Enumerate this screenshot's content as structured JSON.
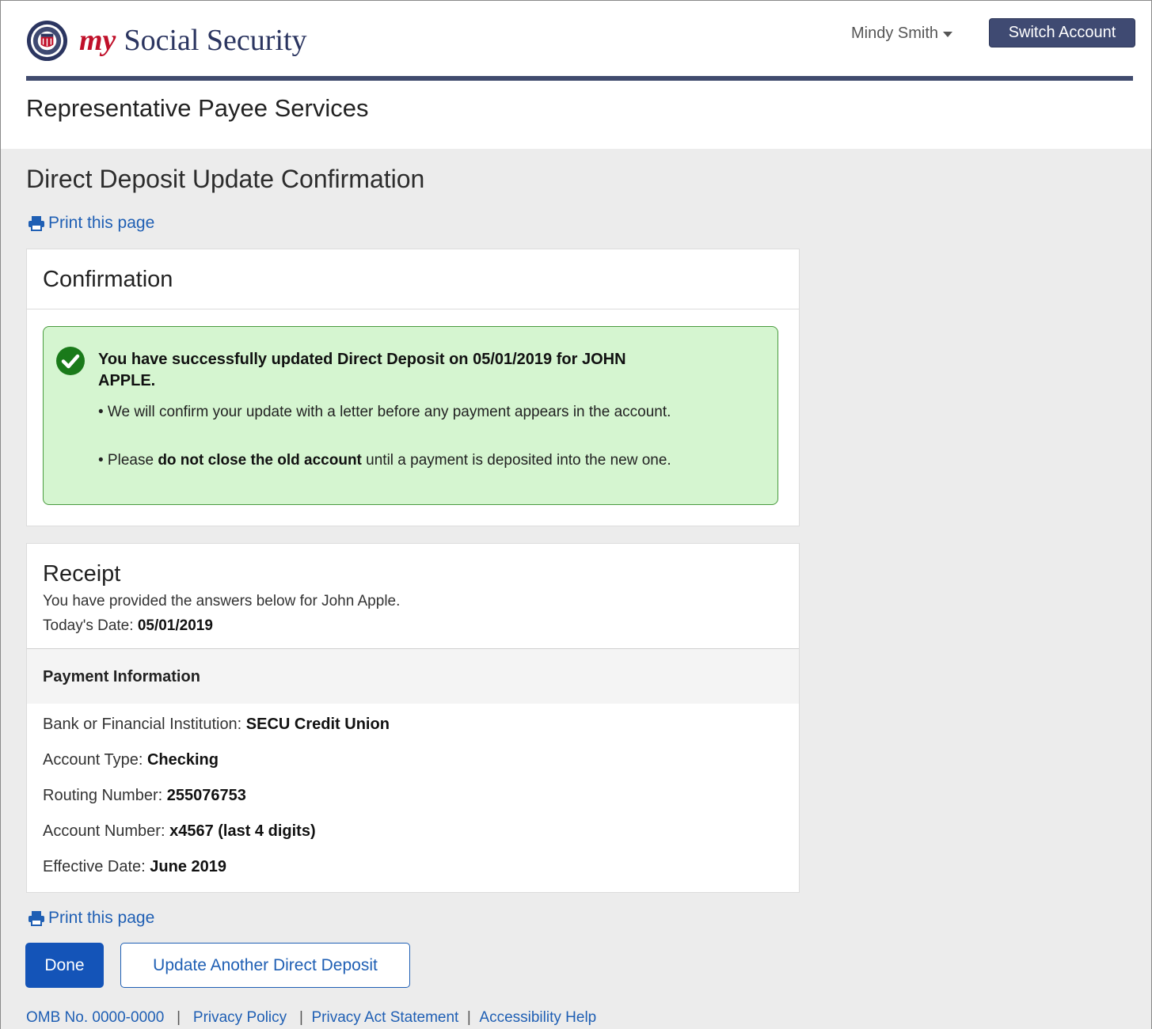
{
  "header": {
    "brand_my": "my",
    "brand_rest": "Social Security",
    "user_name": "Mindy Smith",
    "switch_account": "Switch Account",
    "section_title": "Representative Payee Services"
  },
  "page": {
    "title": "Direct Deposit Update Confirmation",
    "print_link": "Print this page"
  },
  "confirmation": {
    "heading": "Confirmation",
    "alert_title": "You have successfully updated Direct Deposit on 05/01/2019 for JOHN APPLE.",
    "bullet1": "• We will confirm your update with a letter before any payment appears in the account.",
    "bullet2_prefix": "• Please ",
    "bullet2_bold": "do not close the old account",
    "bullet2_suffix": " until a payment is deposited into the new one."
  },
  "receipt": {
    "heading": "Receipt",
    "subtitle": "You have provided the answers below for John Apple.",
    "date_label": "Today's Date: ",
    "date_value": "05/01/2019",
    "payment_heading": "Payment Information",
    "rows": [
      {
        "label": "Bank or Financial Institution: ",
        "value": "SECU Credit Union"
      },
      {
        "label": "Account Type: ",
        "value": "Checking"
      },
      {
        "label": "Routing Number: ",
        "value": "255076753"
      },
      {
        "label": "Account Number: ",
        "value": "x4567 (last 4 digits)"
      },
      {
        "label": "Effective Date: ",
        "value": "June 2019"
      }
    ]
  },
  "actions": {
    "done": "Done",
    "update_another": "Update Another Direct Deposit"
  },
  "footer": {
    "omb": "OMB No. 0000-0000",
    "privacy_policy": "Privacy Policy",
    "privacy_act": "Privacy Act Statement",
    "accessibility": "Accessibility Help",
    "sep": "|"
  },
  "colors": {
    "brand_navy": "#3f4a72",
    "brand_red": "#c0102a",
    "link_blue": "#1f5fb4",
    "primary_button": "#1454b8",
    "success_bg": "#d5f5d0",
    "success_border": "#4a9b3f"
  }
}
